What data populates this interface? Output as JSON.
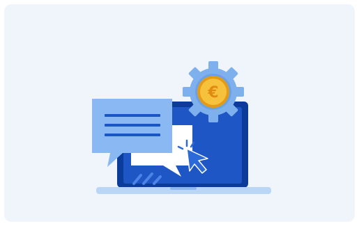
{
  "illustration": {
    "background_color": "#f0f5fc",
    "laptop_frame_color": "#0b3c9a",
    "laptop_screen_color": "#1e56c5",
    "laptop_base_color": "#b9d6f6",
    "chat_bubble_color": "#8ab8f3",
    "chat_lines_color": "#1a56c4",
    "gear_color": "#7fb0ee",
    "coin_color": "#f6c23d",
    "coin_border_color": "#e39b16",
    "coin_symbol": "€",
    "cursor_color": "#2c6ad9",
    "icons": [
      "laptop-icon",
      "chat-bubble-icon",
      "gear-icon",
      "euro-coin-icon",
      "cursor-icon"
    ]
  }
}
